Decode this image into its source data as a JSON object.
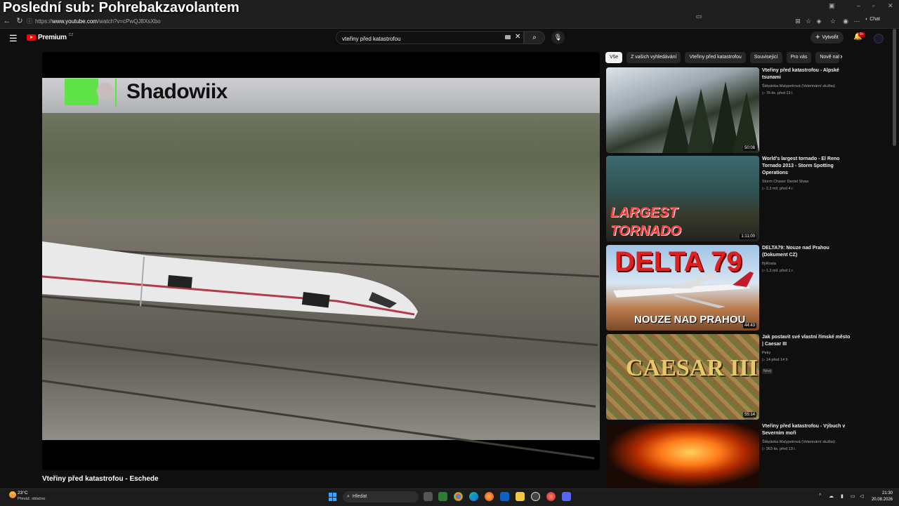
{
  "overlay": {
    "title": "Poslední sub: Pohrebakzavolantem"
  },
  "browser": {
    "url_prefix": "https://",
    "url_domain": "www.youtube.com",
    "url_path": "/watch?v=cPwQJ8XsXbo",
    "chat_label": "Chat"
  },
  "youtube": {
    "logo_text": "Premium",
    "logo_region": "CZ",
    "search_value": "vteřiny před katastrofou",
    "create_label": "Vytvořit",
    "notifications_badge": "9+"
  },
  "video": {
    "title": "Vteřiny před katastrofou - Eschede",
    "watermark": "Shadowiix"
  },
  "chips": [
    "Vše",
    "Z vašich vyhledávání",
    "Vteřiny před katastrofou",
    "Související",
    "Pro vás",
    "Nově nah"
  ],
  "recommendations": [
    {
      "title": "Vteřiny před katastrofou - Alpské tsunami",
      "channel": "Štěpánka Malypetrová (Veterinární služba)",
      "meta": "▷ 76 tis.   před 13 l.",
      "duration": "50:08",
      "badge": ""
    },
    {
      "title": "World's largest tornado - El Reno Tornado 2013 - Storm Spotting Operations",
      "channel": "Storm Chaser Daniel Shaw",
      "meta": "▷ 2,3 mil.   před 4 r.",
      "duration": "1:11:00",
      "badge": "",
      "thumb_text_1": "LARGEST",
      "thumb_text_2": "TORNADO"
    },
    {
      "title": "DELTA79: Nouze nad Prahou (Dokument CZ)",
      "channel": "flyRosta",
      "meta": "▷ 1,3 mil.   před 1 r.",
      "duration": "44:43",
      "badge": "",
      "thumb_text_1": "DELTA 79",
      "thumb_text_2": "NOUZE NAD PRAHOU"
    },
    {
      "title": "Jak postavit své vlastní římské město | Caesar III",
      "channel": "Peky",
      "meta": "▷ 14   před 14 h",
      "duration": "55:14",
      "badge": "Nový",
      "thumb_text_1": "CAESAR III"
    },
    {
      "title": "Vteřiny před katastrofou - Výbuch v Severním moři",
      "channel": "Štěpánka Malypetrová (Veterinární služba)",
      "meta": "▷ 363 tis.   před 13 l.",
      "duration": "",
      "badge": ""
    }
  ],
  "taskbar": {
    "temperature": "23°C",
    "weather": "Převáž. oblačno",
    "search_label": "Hledat",
    "time": "21:30",
    "date": "20.08.2026"
  },
  "colors": {
    "accent": "#ff0000",
    "badge": "#cc0000",
    "background": "#0f0f0f",
    "logo_green": "#5fe349"
  }
}
